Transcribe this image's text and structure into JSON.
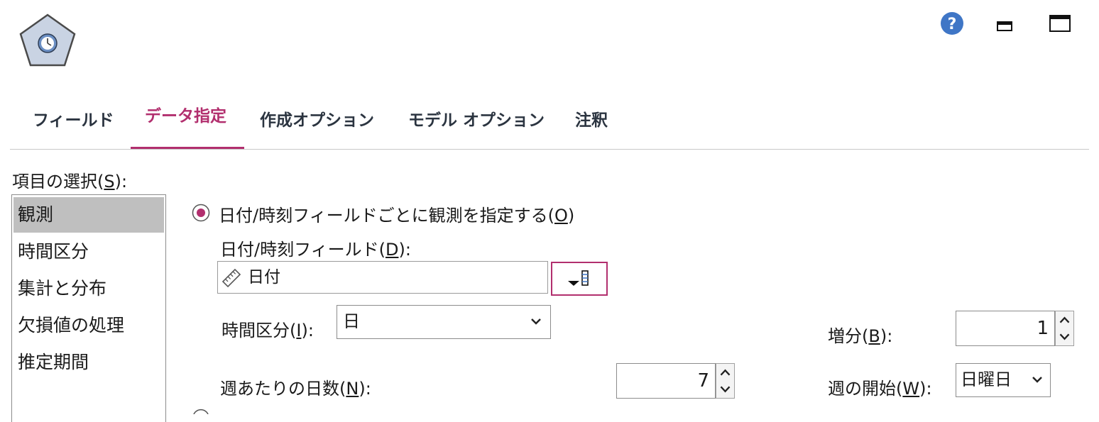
{
  "header": {
    "node_icon": "time-series-node-icon",
    "help_icon": "help-icon",
    "minimize_icon": "minimize-icon",
    "maximize_icon": "maximize-icon"
  },
  "tabs": [
    {
      "label": "フィールド",
      "active": false
    },
    {
      "label": "データ指定",
      "active": true
    },
    {
      "label": "作成オプション",
      "active": false
    },
    {
      "label": "モデル オプション",
      "active": false
    },
    {
      "label": "注釈",
      "active": false
    }
  ],
  "colors": {
    "accent": "#b22f6e",
    "help_blue": "#3f76c6",
    "list_selected": "#bfbfbf"
  },
  "item_list": {
    "label_prefix": "項目の選択(",
    "label_key": "S",
    "label_suffix": "):",
    "items": [
      {
        "label": "観測",
        "selected": true
      },
      {
        "label": "時間区分",
        "selected": false
      },
      {
        "label": "集計と分布",
        "selected": false
      },
      {
        "label": "欠損値の処理",
        "selected": false
      },
      {
        "label": "推定期間",
        "selected": false
      }
    ]
  },
  "observations": {
    "radio_label_prefix": "日付/時刻フィールドごとに観測を指定する(",
    "radio_label_key": "O",
    "radio_label_suffix": ")",
    "radio_checked": true,
    "field_label_prefix": "日付/時刻フィールド(",
    "field_label_key": "D",
    "field_label_suffix": "):",
    "field_value": "日付",
    "field_icon": "date-field-icon",
    "picker_icon": "field-picker-icon",
    "interval_label_prefix": "時間区分(",
    "interval_label_key": "I",
    "interval_label_suffix": "):",
    "interval_value": "日",
    "increment_label_prefix": "増分(",
    "increment_label_key": "B",
    "increment_label_suffix": "):",
    "increment_value": "1",
    "days_label_prefix": "週あたりの日数(",
    "days_label_key": "N",
    "days_label_suffix": "):",
    "days_value": "7",
    "week_start_label_prefix": "週の開始(",
    "week_start_label_key": "W",
    "week_start_label_suffix": "):",
    "week_start_value": "日曜日"
  }
}
